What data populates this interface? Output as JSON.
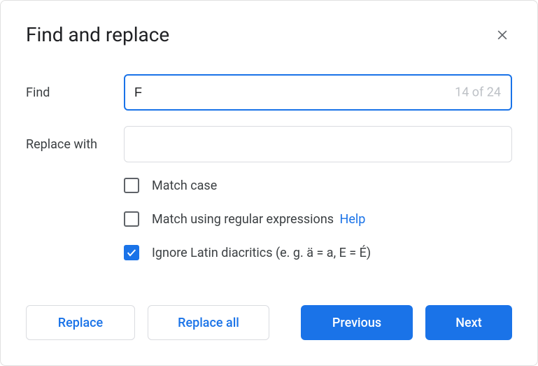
{
  "dialog": {
    "title": "Find and replace"
  },
  "find": {
    "label": "Find",
    "value": "F",
    "count": "14 of 24"
  },
  "replace": {
    "label": "Replace with",
    "value": ""
  },
  "options": {
    "match_case": {
      "label": "Match case",
      "checked": false
    },
    "regex": {
      "label": "Match using regular expressions",
      "help": "Help",
      "checked": false
    },
    "diacritics": {
      "label": "Ignore Latin diacritics (e. g. ä = a, E = É)",
      "checked": true
    }
  },
  "buttons": {
    "replace": "Replace",
    "replace_all": "Replace all",
    "previous": "Previous",
    "next": "Next"
  }
}
